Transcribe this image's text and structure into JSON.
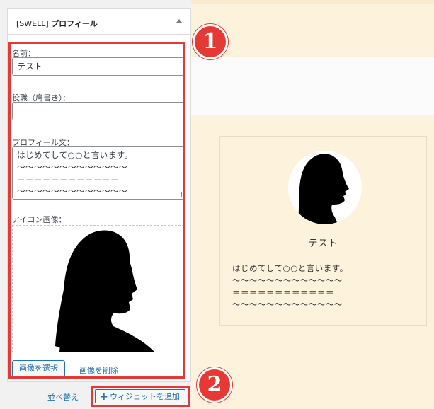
{
  "widget": {
    "title_prefix": "[SWELL]",
    "title_main": "プロフィール",
    "name_label": "名前：",
    "name_value": "テスト",
    "position_label": "役職（肩書き）：",
    "position_value": "",
    "profile_label": "プロフィール文：",
    "profile_lines": [
      "はじめてして○○と言います。",
      "〜〜〜〜〜〜〜〜〜〜〜〜〜",
      "＝＝＝＝＝＝＝＝＝＝＝＝",
      "〜〜〜〜〜〜〜〜〜〜〜〜〜"
    ],
    "icon_label": "アイコン画像：",
    "select_image": "画像を選択",
    "delete_image": "画像を削除",
    "reorder": "並べ替え",
    "add_widget": "ウィジェットを追加"
  },
  "badges": {
    "one": "1",
    "two": "2"
  },
  "preview": {
    "name": "テスト",
    "text_lines": [
      "はじめてして○○と言います。",
      "〜〜〜〜〜〜〜〜〜〜〜〜〜",
      "＝＝＝＝＝＝＝＝＝＝＝＝",
      "〜〜〜〜〜〜〜〜〜〜〜〜〜"
    ]
  },
  "colors": {
    "highlight": "#e53935",
    "link": "#2271b1",
    "preview_bg": "#fdf2dc"
  },
  "icons": [
    "collapse-arrow-icon",
    "plus-icon",
    "silhouette-image"
  ]
}
